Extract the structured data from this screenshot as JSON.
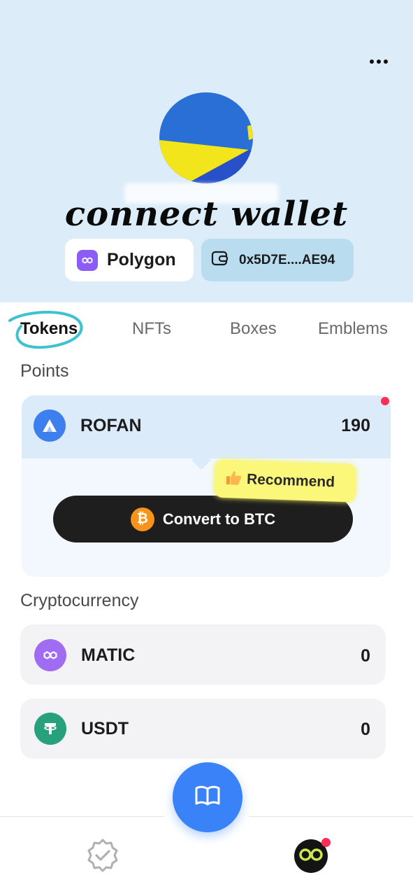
{
  "header": {
    "headline": "connect wallet",
    "chain_label": "Polygon",
    "address_label": "0x5D7E....AE94",
    "colors": {
      "background": "#dcedf9",
      "chain_icon": "#8b5cf6",
      "address_chip": "#b9dcef"
    }
  },
  "tabs": [
    {
      "label": "Tokens",
      "active": true
    },
    {
      "label": "NFTs",
      "active": false
    },
    {
      "label": "Boxes",
      "active": false
    },
    {
      "label": "Emblems",
      "active": false
    }
  ],
  "points": {
    "section_title": "Points",
    "token": {
      "name": "ROFAN",
      "value": "190",
      "icon": "rofan-logo-icon"
    },
    "recommend_badge": {
      "label": "Recommend",
      "icon": "thumbs-up-icon"
    },
    "convert_button": {
      "label": "Convert to BTC",
      "icon": "bitcoin-icon"
    }
  },
  "cryptocurrency": {
    "section_title": "Cryptocurrency",
    "items": [
      {
        "name": "MATIC",
        "value": "0",
        "icon": "polygon-icon",
        "color": "#a06cf2"
      },
      {
        "name": "USDT",
        "value": "0",
        "icon": "tether-icon",
        "color": "#26a17b"
      }
    ]
  },
  "bottom_nav": {
    "items": [
      {
        "icon": "verified-check-icon"
      },
      {
        "icon": "book-icon",
        "primary": true,
        "color": "#3a82f7"
      },
      {
        "icon": "profile-glasses-icon"
      }
    ]
  }
}
